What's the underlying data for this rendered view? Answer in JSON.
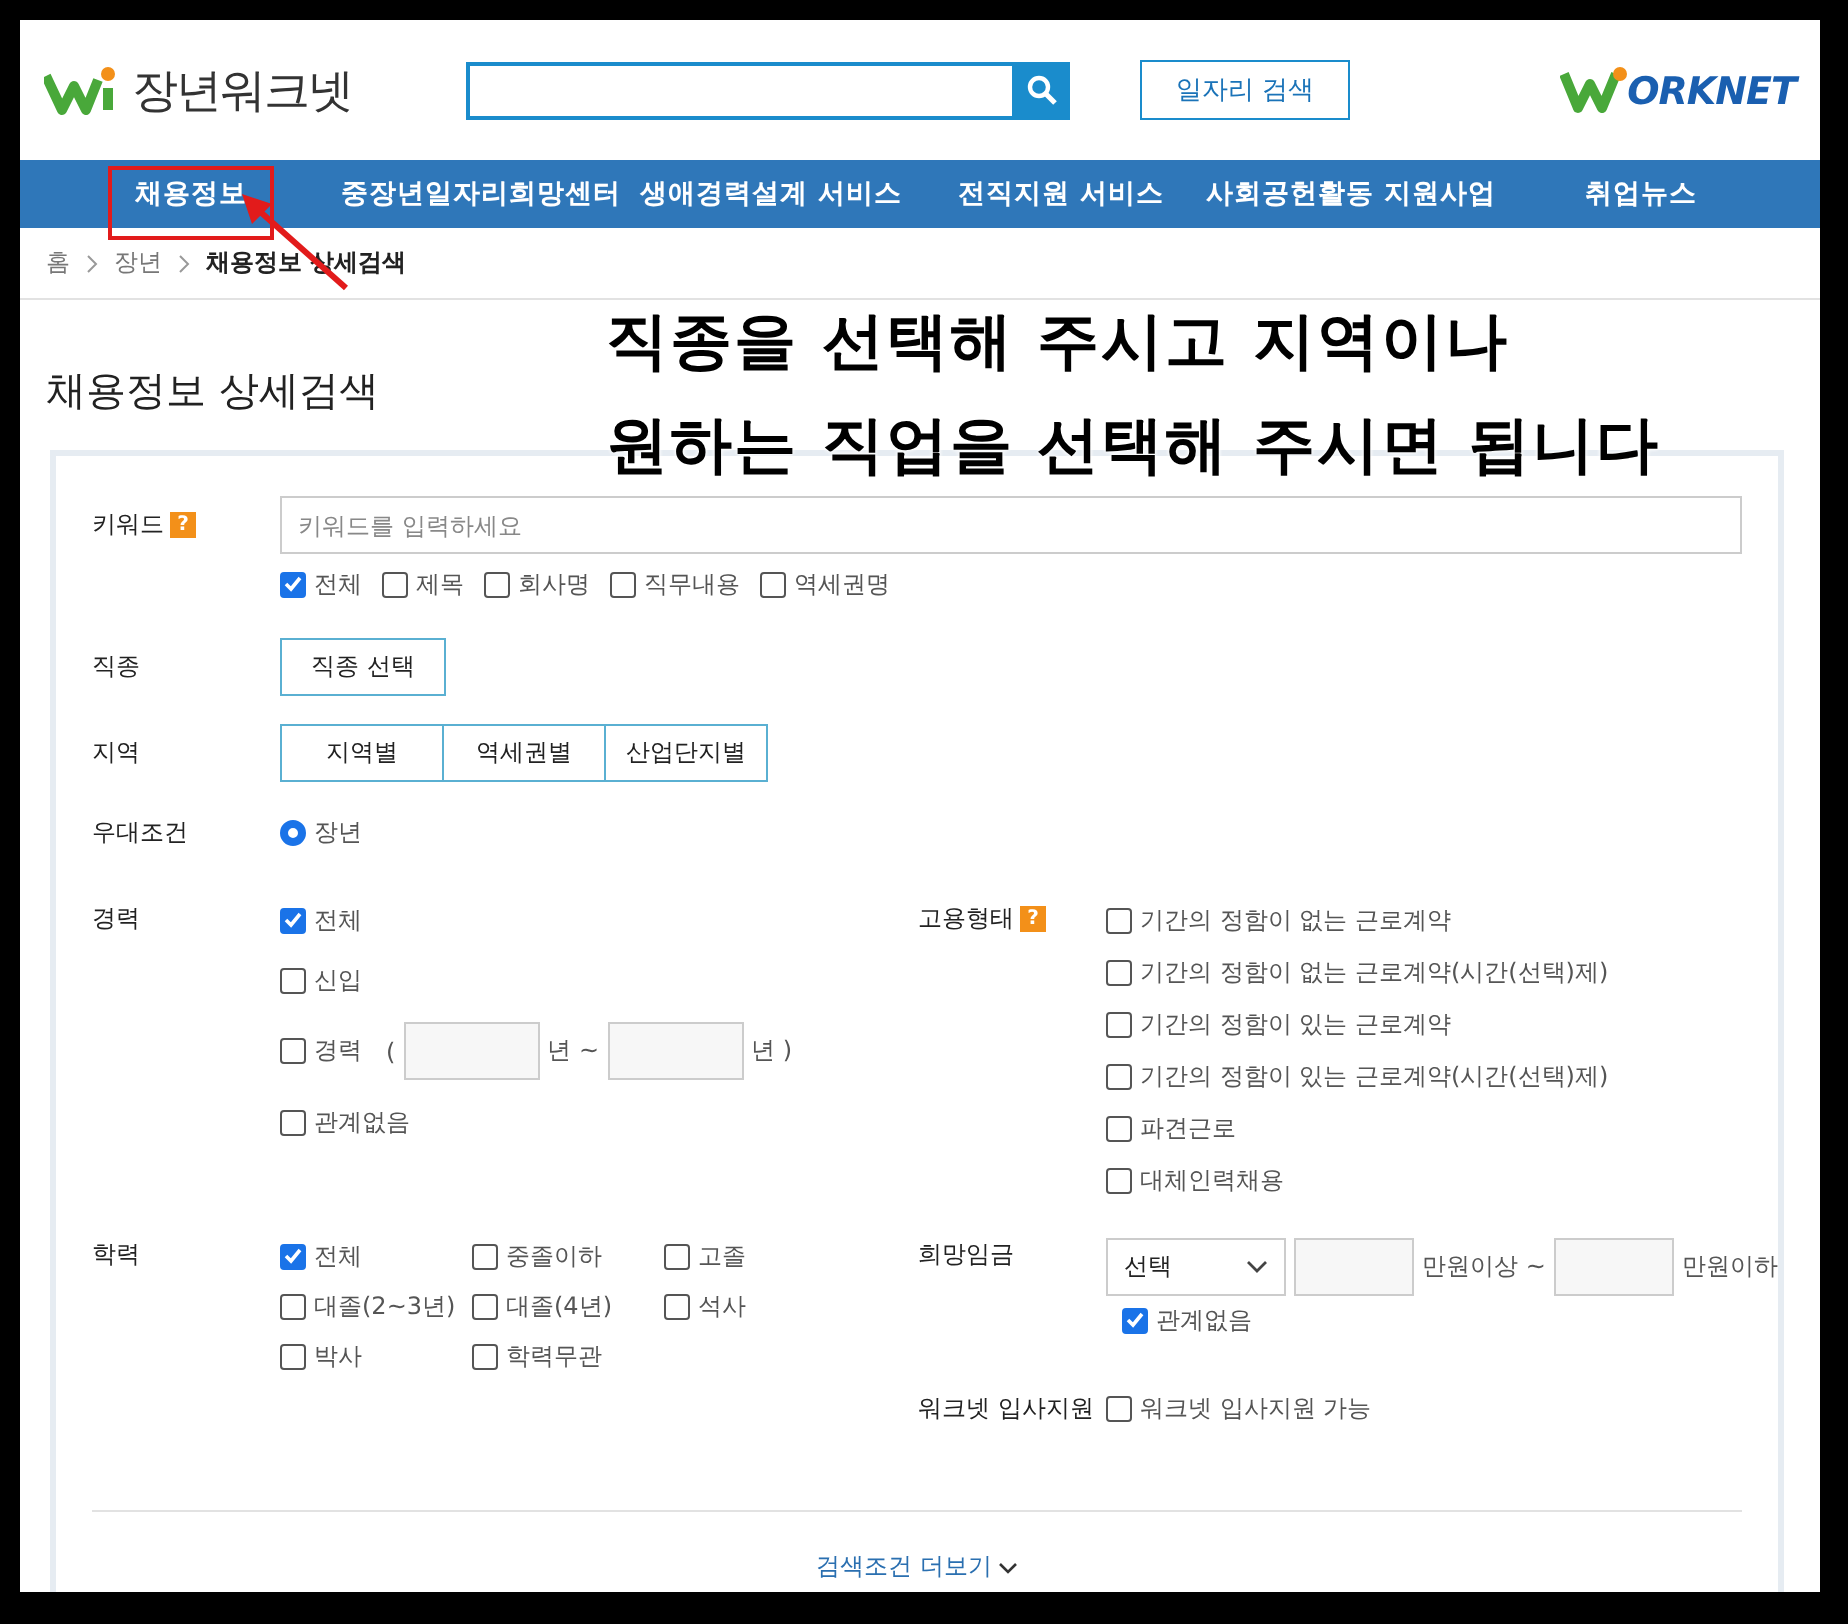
{
  "header": {
    "logo_text": "장년워크넷",
    "job_search_button": "일자리 검색",
    "worknet_logo_text": "ORKNET"
  },
  "nav": {
    "items": [
      {
        "label": "채용정보"
      },
      {
        "label": "중장년일자리희망센터"
      },
      {
        "label": "생애경력설계 서비스"
      },
      {
        "label": "전직지원 서비스"
      },
      {
        "label": "사회공헌활동 지원사업"
      },
      {
        "label": "취업뉴스"
      }
    ]
  },
  "breadcrumb": [
    "홈",
    "장년",
    "채용정보 상세검색"
  ],
  "annotation": {
    "lines": [
      "직종을 선택해 주시고 지역이나",
      "원하는 직업을 선택해 주시면 됩니다"
    ]
  },
  "page_title": "채용정보 상세검색",
  "form": {
    "keyword": {
      "label": "키워드",
      "help": "?",
      "placeholder": "키워드를 입력하세요",
      "options": [
        {
          "label": "전체",
          "checked": true
        },
        {
          "label": "제목",
          "checked": false
        },
        {
          "label": "회사명",
          "checked": false
        },
        {
          "label": "직무내용",
          "checked": false
        },
        {
          "label": "역세권명",
          "checked": false
        }
      ]
    },
    "job": {
      "label": "직종",
      "button": "직종 선택"
    },
    "region": {
      "label": "지역",
      "tabs": [
        {
          "label": "지역별",
          "selected": false
        },
        {
          "label": "역세권별",
          "selected": false
        },
        {
          "label": "산업단지별",
          "selected": false
        }
      ]
    },
    "benefit": {
      "label": "우대조건",
      "options": [
        {
          "label": "장년",
          "selected": true
        }
      ]
    },
    "career": {
      "label": "경력",
      "options": [
        {
          "kind": "plain",
          "label": "전체",
          "checked": true
        },
        {
          "kind": "plain",
          "label": "신입",
          "checked": false
        },
        {
          "kind": "range",
          "label": "경력",
          "checked": false,
          "open": "(",
          "from_unit": "년 ~",
          "to_unit": "년 )"
        },
        {
          "kind": "plain",
          "label": "관계없음",
          "checked": false
        }
      ]
    },
    "employment_type": {
      "label": "고용형태",
      "help": "?",
      "options": [
        {
          "label": "기간의 정함이 없는 근로계약",
          "checked": false
        },
        {
          "label": "기간의 정함이 없는 근로계약(시간(선택)제)",
          "checked": false
        },
        {
          "label": "기간의 정함이 있는 근로계약",
          "checked": false
        },
        {
          "label": "기간의 정함이 있는 근로계약(시간(선택)제)",
          "checked": false
        },
        {
          "label": "파견근로",
          "checked": false
        },
        {
          "label": "대체인력채용",
          "checked": false
        }
      ]
    },
    "education": {
      "label": "학력",
      "options": [
        {
          "label": "전체",
          "checked": true
        },
        {
          "label": "중졸이하",
          "checked": false
        },
        {
          "label": "고졸",
          "checked": false
        },
        {
          "label": "대졸(2~3년)",
          "checked": false
        },
        {
          "label": "대졸(4년)",
          "checked": false
        },
        {
          "label": "석사",
          "checked": false
        },
        {
          "label": "박사",
          "checked": false
        },
        {
          "label": "학력무관",
          "checked": false
        }
      ]
    },
    "salary": {
      "label": "희망임금",
      "select": "선택",
      "min_unit": "만원이상 ~",
      "max_unit": "만원이하",
      "any": {
        "label": "관계없음",
        "checked": true
      }
    },
    "worknet_apply": {
      "label": "워크넷 입사지원",
      "options": [
        {
          "label": "워크넷 입사지원 가능",
          "checked": false
        }
      ]
    },
    "more_button": "검색조건 더보기"
  }
}
